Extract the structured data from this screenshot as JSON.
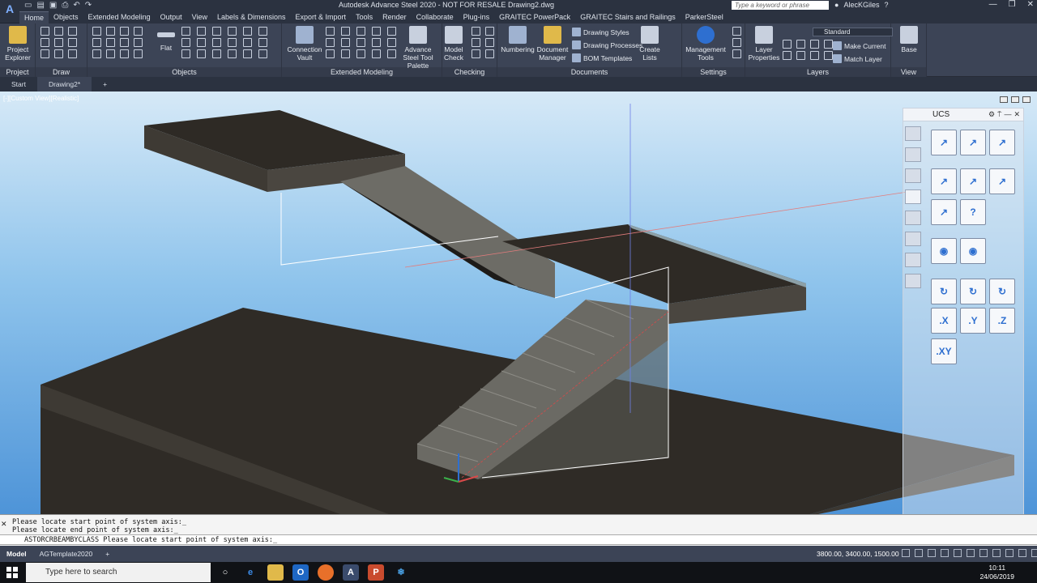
{
  "window": {
    "title": "Autodesk Advance Steel 2020 - NOT FOR RESALE   Drawing2.dwg",
    "search_placeholder": "Type a keyword or phrase",
    "user": "AlecKGiles",
    "app_logo": "A"
  },
  "menu_tabs": [
    "Home",
    "Objects",
    "Extended Modeling",
    "Output",
    "View",
    "Labels & Dimensions",
    "Export & Import",
    "Tools",
    "Render",
    "Collaborate",
    "Plug-ins",
    "GRAITEC PowerPack",
    "GRAITEC Stairs and Railings",
    "ParkerSteel"
  ],
  "ribbon": {
    "project_explorer": "Project Explorer",
    "panel_project": "Project",
    "panel_draw": "Draw",
    "flat": "Flat",
    "panel_objects": "Objects",
    "connection_vault": "Connection Vault",
    "panel_extended_modeling": "Extended Modeling",
    "advance_steel_tool_palette": "Advance Steel Tool Palette",
    "model_check": "Model Check",
    "panel_checking": "Checking",
    "numbering": "Numbering",
    "document_manager": "Document Manager",
    "drawing_styles": "Drawing Styles",
    "drawing_processes": "Drawing Processes",
    "bom_templates": "BOM Templates",
    "create_lists": "Create Lists",
    "panel_documents": "Documents",
    "management_tools": "Management Tools",
    "panel_settings": "Settings",
    "layer_properties": "Layer Properties",
    "layer_combo": "Standard",
    "make_current": "Make Current",
    "match_layer": "Match Layer",
    "panel_layers": "Layers",
    "base": "Base",
    "panel_view": "View"
  },
  "doc_tabs": [
    "Start",
    "Drawing2*"
  ],
  "viewport": {
    "label": "[-][Custom View][Realistic]"
  },
  "ucs": {
    "title": "UCS",
    "buttons": [
      ".X",
      ".Y",
      ".Z",
      ".XY"
    ]
  },
  "command": {
    "history": [
      "Please locate start point of system axis:_",
      "Please locate end point of system axis:_"
    ],
    "prompt": "ASTORCRBEAMBYCLASS Please locate start point of system axis:_"
  },
  "status": {
    "layouts": [
      "Model",
      "AGTemplate2020"
    ],
    "coords": "3800.00, 3400.00, 1500.00"
  },
  "taskbar": {
    "search": "Type here to search",
    "time": "10:11",
    "date": "24/06/2019"
  }
}
